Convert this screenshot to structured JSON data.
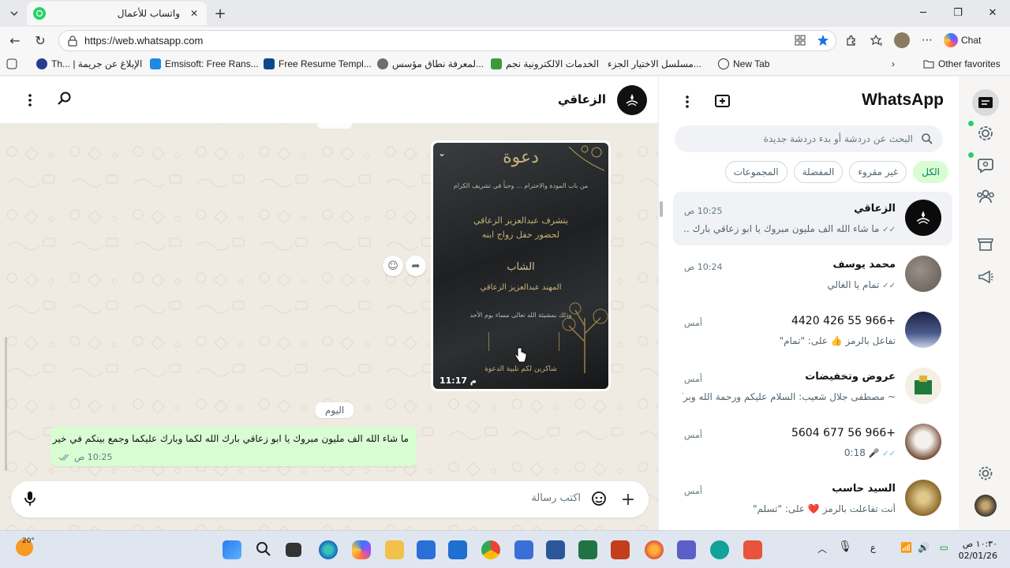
{
  "browser": {
    "tab_title": "واتساب للأعمال",
    "url": "https://web.whatsapp.com",
    "chat_label": "Chat",
    "bookmarks": [
      "Th... | الإبلاغ عن جريمة",
      "Emsisoft: Free Rans...",
      "Free Resume Templ...",
      "لمعرفة نطاق مؤسس...",
      "الخدمات الالكترونية نجم",
      "مسلسل الاختيار الجزء...",
      "New Tab"
    ],
    "other_favorites": "Other favorites"
  },
  "sidebar_icons": [
    "chats-icon",
    "status-icon",
    "channels-icon",
    "communities-icon",
    "catalog-icon",
    "broadcast-icon",
    "settings-icon",
    "profile-avatar"
  ],
  "chatlist": {
    "title": "WhatsApp",
    "search_placeholder": "البحث عن دردشة أو بدء دردشة جديدة",
    "filters": [
      "الكل",
      "غير مقروء",
      "المفضلة",
      "المجموعات"
    ],
    "active_filter": "الكل",
    "chats": [
      {
        "name": "الزعاقي",
        "time": "10:25 ص",
        "message": "ما شاء الله الف مليون مبروك يا ابو زعاقي بارك ...",
        "ticks": "double-gray",
        "selected": true
      },
      {
        "name": "محمد يوسف",
        "time": "10:24 ص",
        "message": "تمام يا الغالي",
        "ticks": "double-gray",
        "selected": false
      },
      {
        "name": "+966 55 426 4420",
        "time": "أمس",
        "message": "تفاعل بالرمز 👍 على: \"تمام\"",
        "ticks": "",
        "selected": false
      },
      {
        "name": "عروض وتخفيضات",
        "time": "أمس",
        "message": "~ مصطفى جلال شعيب: السلام عليكم ورحمة الله وبركا...",
        "ticks": "",
        "selected": false
      },
      {
        "name": "+966 56 677 5604",
        "time": "أمس",
        "message": "0:18",
        "ticks": "double-blue",
        "selected": false
      },
      {
        "name": "السيد حاسب",
        "time": "أمس",
        "message": "أنت تفاعلت بالرمز ❤️ على: \"تسلم\"",
        "ticks": "",
        "selected": false
      }
    ]
  },
  "conversation": {
    "contact_name": "الزعاقي",
    "image_message": {
      "time": "11:17 م",
      "invitation_lines": [
        "دعوة",
        "من باب المودة والاحترام ... وحباً في تشريف الكرام",
        "يتشرف عبدالعزيز الزعاقي",
        "لحضور حفل زواج ابنه",
        "الشاب",
        "المهند عبدالعزيز الزعاقي",
        "وذلك بمشيئة الله تعالى مساء يوم الأحد",
        "شاكرين لكم تلبية الدعوة"
      ]
    },
    "date_separator": "اليوم",
    "outgoing_message": {
      "text": "ما شاء الله الف مليون مبروك يا ابو زعاقي بارك الله لكما وبارك عليكما وجمع بينكم في خير",
      "time": "10:25 ص"
    },
    "composer_placeholder": "اكتب رسالة"
  },
  "taskbar": {
    "weather_temp": "20°",
    "time": "١٠:٣٠ ص",
    "date": "02/01/26",
    "lang": "ع"
  },
  "colors": {
    "wa_green": "#25d366",
    "wa_teal": "#008069",
    "outgoing_bubble": "#d9fdd3",
    "chat_bg": "#efeae2",
    "active_chip": "#d9fdd3",
    "blue_tick": "#53bdeb"
  }
}
